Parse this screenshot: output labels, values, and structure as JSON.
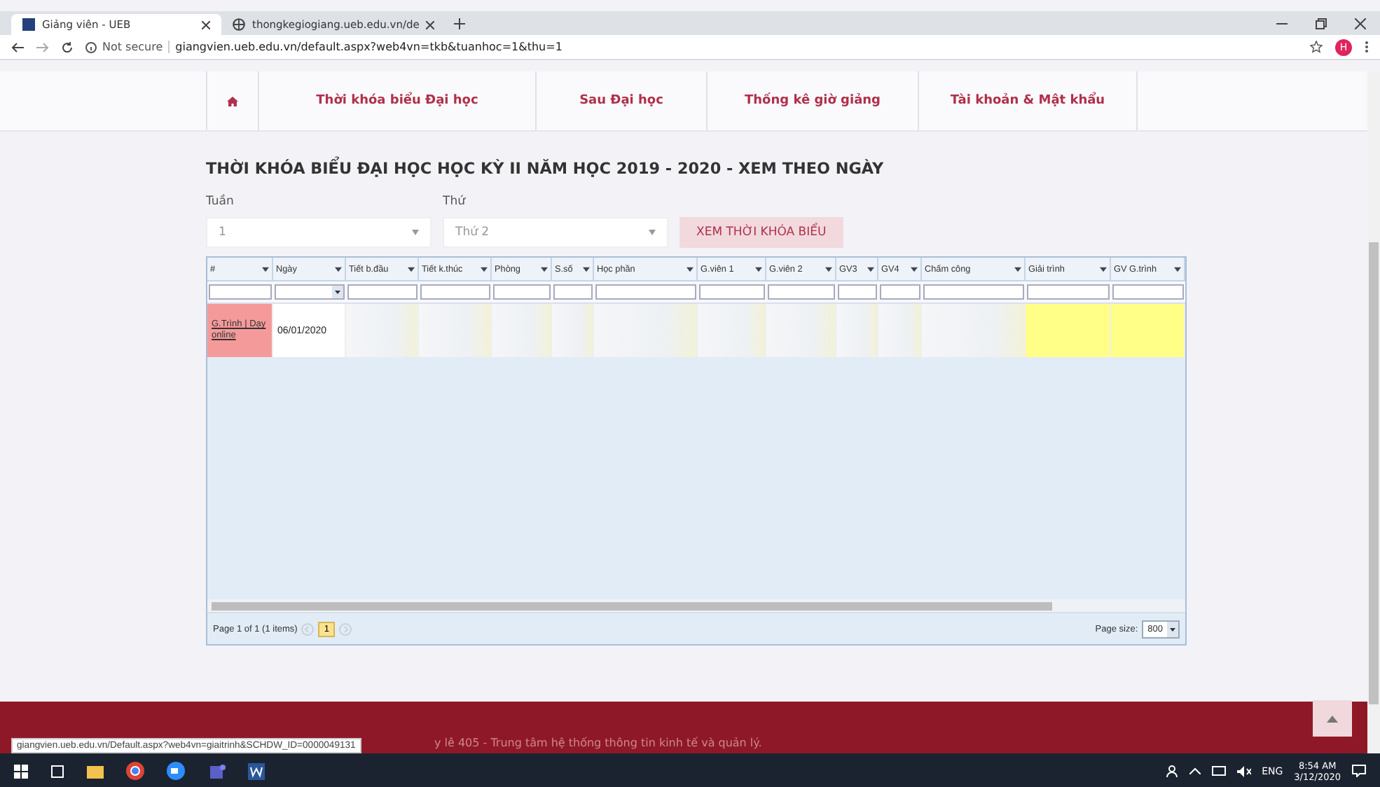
{
  "browser": {
    "tabs": [
      {
        "title": "Giảng viên - UEB",
        "selected": true
      },
      {
        "title": "thongkegiogiang.ueb.edu.vn/de",
        "selected": false
      }
    ],
    "security": "Not secure",
    "url": "giangvien.ueb.edu.vn/default.aspx?web4vn=tkb&tuanhoc=1&thu=1",
    "profile": "H"
  },
  "nav": {
    "items": [
      {
        "label": "Thời khóa biểu Đại học"
      },
      {
        "label": "Sau Đại học"
      },
      {
        "label": "Thống kê giờ giảng"
      },
      {
        "label": "Tài khoản & Mật khẩu"
      }
    ]
  },
  "page_title": "THỜI KHÓA BIỂU ĐẠI HỌC HỌC KỲ II NĂM HỌC 2019 - 2020 - XEM THEO NGÀY",
  "filters": [
    {
      "label": "Tuần",
      "value": "1"
    },
    {
      "label": "Thứ",
      "value": "Thứ 2"
    }
  ],
  "view_button": "XEM THỜI KHÓA BIỂU",
  "table": {
    "columns": [
      "#",
      "Ngày",
      "Tiết b.đầu",
      "Tiết k.thúc",
      "Phòng",
      "S.số",
      "Học phần",
      "G.viên 1",
      "G.viên 2",
      "GV3",
      "GV4",
      "Chấm công",
      "Giải trình",
      "GV G.trình"
    ],
    "rows": [
      {
        "action": "G.Trình | Dạy online",
        "date": "06/01/2020"
      }
    ]
  },
  "pager": {
    "summary": "Page 1 of 1 (1 items)",
    "pages": [
      {
        "label": "1",
        "selected": true
      }
    ],
    "page_size_label": "Page size:",
    "page_size": "800"
  },
  "footer": "y lê 405 - Trung tâm hệ thống thông tin kinh tế và quản lý.",
  "status_link": "giangvien.ueb.edu.vn/Default.aspx?web4vn=giaitrinh&SCHDW_ID=0000049131",
  "taskbar": {
    "language": "ENG",
    "time": "8:54 AM",
    "date": "3/12/2020"
  }
}
